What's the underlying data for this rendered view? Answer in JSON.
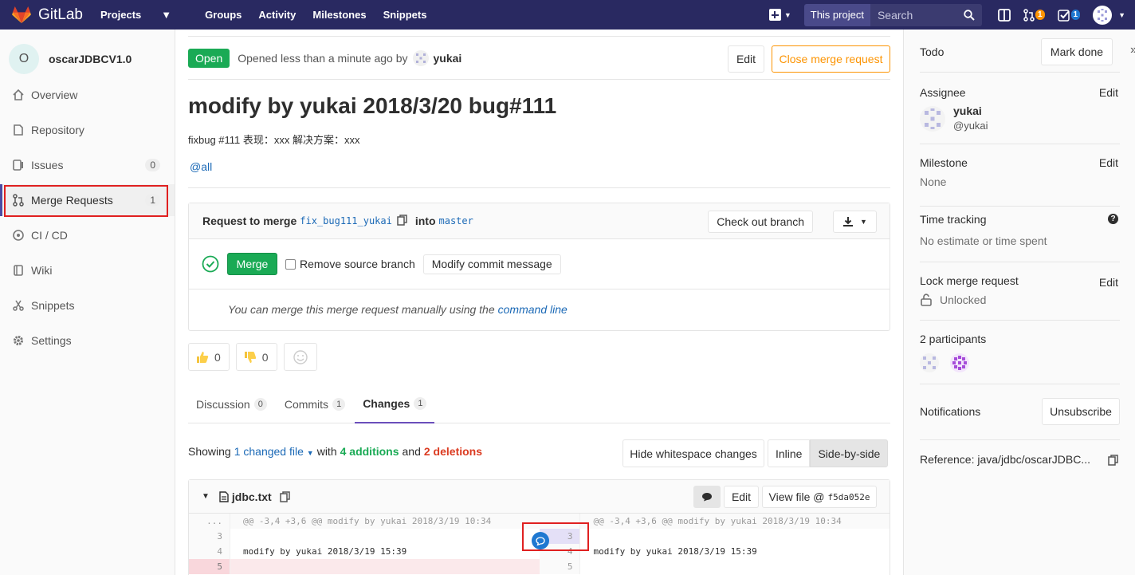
{
  "nav": {
    "brand": "GitLab",
    "links": [
      {
        "label": "Projects",
        "has_caret": true
      },
      {
        "label": "Groups"
      },
      {
        "label": "Activity"
      },
      {
        "label": "Milestones"
      },
      {
        "label": "Snippets"
      }
    ],
    "search_scope": "This project",
    "search_placeholder": "Search",
    "mr_count": "1",
    "todo_count": "1"
  },
  "sidebar": {
    "project_initial": "O",
    "project_name": "oscarJDBCV1.0",
    "items": [
      {
        "label": "Overview",
        "icon": "home-icon"
      },
      {
        "label": "Repository",
        "icon": "repository-icon"
      },
      {
        "label": "Issues",
        "icon": "issues-icon",
        "badge": "0"
      },
      {
        "label": "Merge Requests",
        "icon": "merge-request-icon",
        "badge": "1",
        "active": true
      },
      {
        "label": "CI / CD",
        "icon": "ci-cd-icon"
      },
      {
        "label": "Wiki",
        "icon": "wiki-icon"
      },
      {
        "label": "Snippets",
        "icon": "snippets-icon"
      },
      {
        "label": "Settings",
        "icon": "settings-icon"
      }
    ]
  },
  "mr": {
    "status": "Open",
    "opened_prefix": "Opened less than a minute ago by",
    "author": "yukai",
    "edit_label": "Edit",
    "close_label": "Close merge request",
    "title": "modify by yukai 2018/3/20 bug#111",
    "description": "fixbug #111 表现：xxx 解决方案：xxx",
    "mention": "@all"
  },
  "widget": {
    "request_label": "Request to merge",
    "source_branch": "fix_bug111_yukai",
    "into_label": "into",
    "target_branch": "master",
    "checkout_label": "Check out branch",
    "merge_label": "Merge",
    "remove_source_label": "Remove source branch",
    "modify_commit_label": "Modify commit message",
    "manual_text": "You can merge this merge request manually using the",
    "command_line_label": "command line"
  },
  "awards": {
    "thumbs_up": "0",
    "thumbs_down": "0"
  },
  "tabs": [
    {
      "label": "Discussion",
      "count": "0"
    },
    {
      "label": "Commits",
      "count": "1"
    },
    {
      "label": "Changes",
      "count": "1",
      "active": true
    }
  ],
  "changes": {
    "showing": "Showing",
    "changed_files": "1 changed file",
    "with": "with",
    "additions": "4 additions",
    "and": "and",
    "deletions": "2 deletions",
    "hide_whitespace": "Hide whitespace changes",
    "inline": "Inline",
    "side_by_side": "Side-by-side"
  },
  "file": {
    "name": "jdbc.txt",
    "edit_label": "Edit",
    "view_file_label": "View file @",
    "commit_sha": "f5da052e",
    "hunk_header": "@@ -3,4 +3,6 @@ modify by yukai 2018/3/19 10:34",
    "left_lines": [
      {
        "num": "...",
        "text": ""
      },
      {
        "num": "3",
        "text": ""
      },
      {
        "num": "4",
        "text": "modify by yukai 2018/3/19 15:39"
      },
      {
        "num": "5",
        "text": ""
      }
    ],
    "right_lines": [
      {
        "num": "...",
        "text": ""
      },
      {
        "num": "3",
        "text": ""
      },
      {
        "num": "4",
        "text": "modify by yukai 2018/3/19 15:39"
      },
      {
        "num": "5",
        "text": ""
      }
    ]
  },
  "right_sidebar": {
    "todo_label": "Todo",
    "mark_done_label": "Mark done",
    "assignee_label": "Assignee",
    "assignee_name": "yukai",
    "assignee_username": "@yukai",
    "milestone_label": "Milestone",
    "milestone_value": "None",
    "time_tracking_label": "Time tracking",
    "time_tracking_value": "No estimate or time spent",
    "lock_label": "Lock merge request",
    "lock_value": "Unlocked",
    "participants_label": "2 participants",
    "notifications_label": "Notifications",
    "unsubscribe_label": "Unsubscribe",
    "reference_text": "Reference: java/jdbc/oscarJDBC...",
    "edit_label": "Edit"
  }
}
